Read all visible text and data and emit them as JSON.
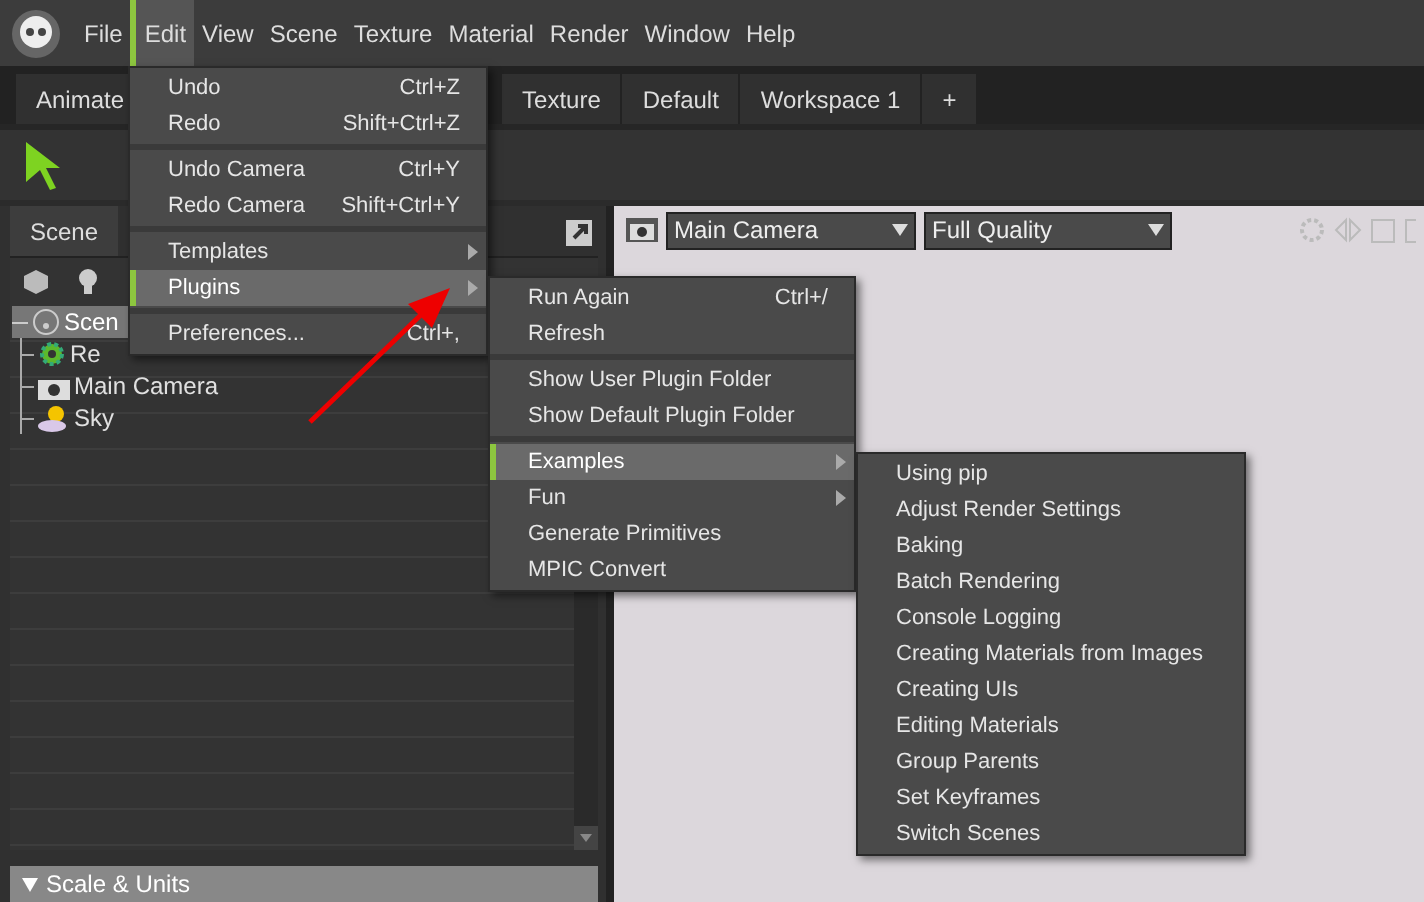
{
  "menubar": [
    {
      "label": "File",
      "selected": false
    },
    {
      "label": "Edit",
      "selected": true
    },
    {
      "label": "View",
      "selected": false
    },
    {
      "label": "Scene",
      "selected": false
    },
    {
      "label": "Texture",
      "selected": false
    },
    {
      "label": "Material",
      "selected": false
    },
    {
      "label": "Render",
      "selected": false
    },
    {
      "label": "Window",
      "selected": false
    },
    {
      "label": "Help",
      "selected": false
    }
  ],
  "workspace_tabs": [
    {
      "label": "Animate"
    },
    {
      "label": "Texture"
    },
    {
      "label": "Default"
    },
    {
      "label": "Workspace 1"
    },
    {
      "label": "+"
    }
  ],
  "scene_panel": {
    "tab": "Scene",
    "tree": [
      {
        "label": "Scen",
        "expanded": true,
        "selected": true,
        "children": [
          {
            "label": "Re"
          },
          {
            "label": "Main Camera"
          },
          {
            "label": "Sky"
          }
        ]
      }
    ],
    "section": "Scale & Units"
  },
  "viewport": {
    "camera": "Main Camera",
    "quality": "Full Quality"
  },
  "edit_menu": [
    [
      {
        "label": "Undo",
        "shortcut": "Ctrl+Z",
        "submenu": false,
        "selected": false
      },
      {
        "label": "Redo",
        "shortcut": "Shift+Ctrl+Z",
        "submenu": false,
        "selected": false
      }
    ],
    [
      {
        "label": "Undo Camera",
        "shortcut": "Ctrl+Y",
        "submenu": false,
        "selected": false
      },
      {
        "label": "Redo Camera",
        "shortcut": "Shift+Ctrl+Y",
        "submenu": false,
        "selected": false
      }
    ],
    [
      {
        "label": "Templates",
        "submenu": true,
        "selected": false
      },
      {
        "label": "Plugins",
        "submenu": true,
        "selected": true
      }
    ],
    [
      {
        "label": "Preferences...",
        "shortcut": "Ctrl+,",
        "submenu": false,
        "selected": false
      }
    ]
  ],
  "plugins_menu": [
    [
      {
        "label": "Run Again",
        "shortcut": "Ctrl+/",
        "submenu": false,
        "selected": false
      },
      {
        "label": "Refresh",
        "submenu": false,
        "selected": false
      }
    ],
    [
      {
        "label": "Show User Plugin Folder",
        "submenu": false,
        "selected": false
      },
      {
        "label": "Show Default Plugin Folder",
        "submenu": false,
        "selected": false
      }
    ],
    [
      {
        "label": "Examples",
        "submenu": true,
        "selected": true
      },
      {
        "label": "Fun",
        "submenu": true,
        "selected": false
      },
      {
        "label": "Generate Primitives",
        "submenu": false,
        "selected": false
      },
      {
        "label": "MPIC Convert",
        "submenu": false,
        "selected": false
      }
    ]
  ],
  "examples_menu": [
    [
      {
        "label": "Using pip",
        "submenu": false,
        "selected": false
      },
      {
        "label": "Adjust Render Settings",
        "submenu": false,
        "selected": false
      },
      {
        "label": "Baking",
        "submenu": false,
        "selected": false
      },
      {
        "label": "Batch Rendering",
        "submenu": false,
        "selected": false
      },
      {
        "label": "Console Logging",
        "submenu": false,
        "selected": false
      },
      {
        "label": "Creating Materials from Images",
        "submenu": false,
        "selected": false
      },
      {
        "label": "Creating UIs",
        "submenu": false,
        "selected": false
      },
      {
        "label": "Editing Materials",
        "submenu": false,
        "selected": false
      },
      {
        "label": "Group Parents",
        "submenu": false,
        "selected": false
      },
      {
        "label": "Set Keyframes",
        "submenu": false,
        "selected": false
      },
      {
        "label": "Switch Scenes",
        "submenu": false,
        "selected": false
      }
    ]
  ]
}
